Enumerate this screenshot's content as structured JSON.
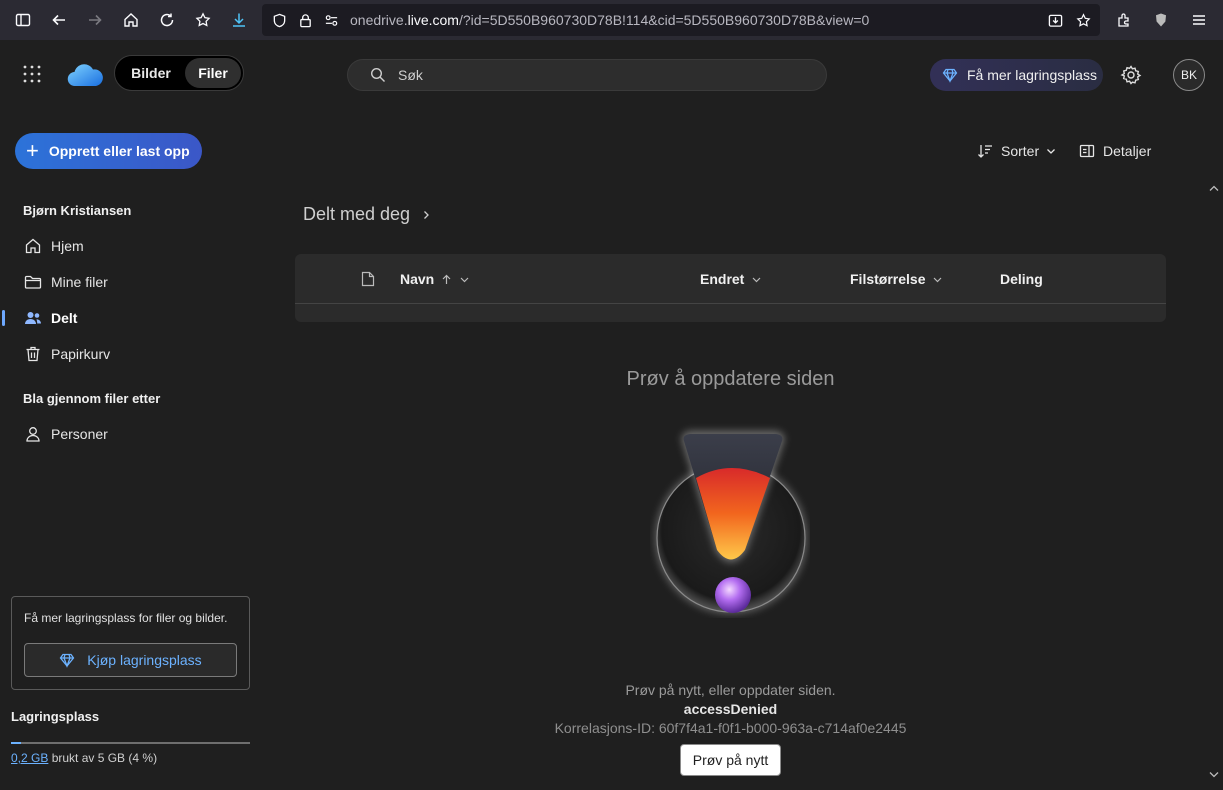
{
  "browser": {
    "url_prefix": "onedrive.",
    "url_host": "live.com",
    "url_rest": "/?id=5D550B960730D78B!114&cid=5D550B960730D78B&view=0"
  },
  "topbar": {
    "segment": {
      "photos": "Bilder",
      "files": "Filer"
    },
    "search_placeholder": "Søk",
    "premium_label": "Få mer lagringsplass",
    "avatar_initials": "BK"
  },
  "sidebar": {
    "create_label": "Opprett eller last opp",
    "user_name": "Bjørn Kristiansen",
    "items": [
      {
        "label": "Hjem",
        "icon": "home-icon"
      },
      {
        "label": "Mine filer",
        "icon": "folder-icon"
      },
      {
        "label": "Delt",
        "icon": "people-icon",
        "active": true
      },
      {
        "label": "Papirkurv",
        "icon": "trash-icon"
      }
    ],
    "browse_title": "Bla gjennom filer etter",
    "browse_items": [
      {
        "label": "Personer",
        "icon": "person-icon"
      }
    ],
    "upsell_text": "Få mer lagringsplass for filer og bilder.",
    "buy_label": "Kjøp lagringsplass",
    "storage_title": "Lagringsplass",
    "storage_used": "0,2 GB",
    "storage_rest": " brukt av 5 GB (4 %)",
    "storage_fraction": 0.04
  },
  "main": {
    "sort_label": "Sorter",
    "details_label": "Detaljer",
    "breadcrumb": "Delt med deg",
    "columns": {
      "name": "Navn",
      "modified": "Endret",
      "size": "Filstørrelse",
      "sharing": "Deling"
    },
    "error": {
      "title": "Prøv å oppdatere siden",
      "message": "Prøv på nytt, eller oppdater siden.",
      "code": "accessDenied",
      "correlation": "Korrelasjons-ID: 60f7f4a1-f0f1-b000-963a-c714af0e2445",
      "retry_label": "Prøv på nytt"
    }
  },
  "colors": {
    "accent": "#6cb2ff",
    "background": "#1f1f1f",
    "create_button": "#2c73d9"
  }
}
